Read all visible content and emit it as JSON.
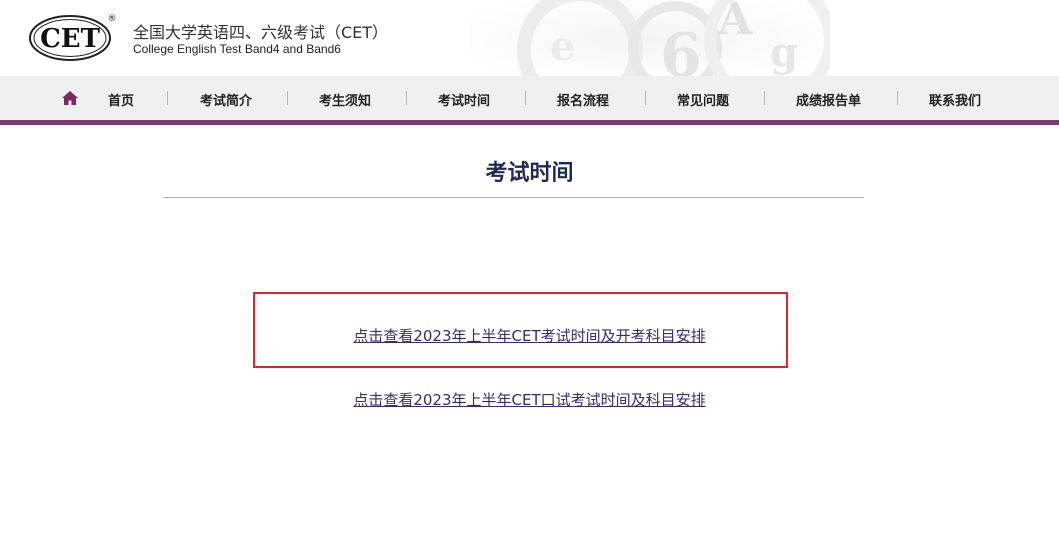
{
  "header": {
    "logo_text": "CET",
    "logo_mark": "®",
    "title_cn": "全国大学英语四、六级考试（CET）",
    "title_en": "College English Test Band4 and Band6",
    "deco_letters": [
      "A",
      "g",
      "6",
      "e"
    ]
  },
  "nav": {
    "home_icon": "home-icon",
    "items": [
      {
        "label": "首页"
      },
      {
        "label": "考试简介"
      },
      {
        "label": "考生须知"
      },
      {
        "label": "考试时间"
      },
      {
        "label": "报名流程"
      },
      {
        "label": "常见问题"
      },
      {
        "label": "成绩报告单"
      },
      {
        "label": "联系我们"
      }
    ],
    "accent_color": "#7a3d6e"
  },
  "main": {
    "title": "考试时间",
    "links": [
      {
        "label": "点击查看2023年上半年CET考试时间及开考科目安排",
        "highlighted": true
      },
      {
        "label": "点击查看2023年上半年CET口试考试时间及科目安排",
        "highlighted": false
      }
    ],
    "highlight_color": "#e0242f"
  }
}
